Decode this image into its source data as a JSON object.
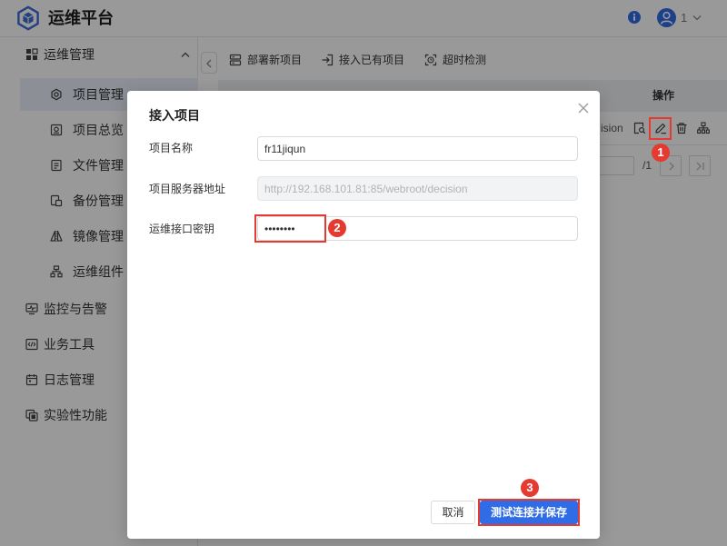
{
  "app": {
    "title": "运维平台",
    "logo_icon": "logo-cube-icon"
  },
  "header": {
    "user_label": "1",
    "icons": {
      "info": "info-icon",
      "avatar": "avatar-icon",
      "dropdown": "chevron-down-icon"
    }
  },
  "sidebar": {
    "section": {
      "label": "运维管理",
      "icon": "grid-icon",
      "expanded": true
    },
    "items": [
      {
        "label": "项目管理",
        "icon": "gear-icon",
        "selected": true
      },
      {
        "label": "项目总览",
        "icon": "overview-icon"
      },
      {
        "label": "文件管理",
        "icon": "file-icon"
      },
      {
        "label": "备份管理",
        "icon": "backup-icon"
      },
      {
        "label": "镜像管理",
        "icon": "mirror-icon"
      },
      {
        "label": "运维组件",
        "icon": "component-icon"
      }
    ],
    "groups": [
      {
        "label": "监控与告警",
        "icon": "monitor-icon"
      },
      {
        "label": "业务工具",
        "icon": "code-icon"
      },
      {
        "label": "日志管理",
        "icon": "calendar-icon"
      },
      {
        "label": "实验性功能",
        "icon": "lab-icon"
      }
    ]
  },
  "toolbar": {
    "deploy_label": "部署新项目",
    "connect_label": "接入已有项目",
    "timeout_label": "超时检测"
  },
  "table": {
    "action_header": "操作",
    "row": {
      "address_visible": "ision",
      "actions": [
        "view-icon",
        "edit-icon",
        "delete-icon",
        "tree-icon"
      ]
    }
  },
  "pagination": {
    "total": "/1"
  },
  "modal": {
    "title": "接入项目",
    "fields": [
      {
        "label": "项目名称",
        "value": "fr11jiqun"
      },
      {
        "label": "项目服务器地址",
        "value": "http://192.168.101.81:85/webroot/decision",
        "disabled": true
      },
      {
        "label": "运维接口密钥",
        "value": "••••••••",
        "type": "password"
      }
    ],
    "cancel_label": "取消",
    "save_label": "测试连接并保存"
  },
  "annotations": {
    "step1": "1",
    "step2": "2",
    "step3": "3"
  },
  "colors": {
    "primary": "#2f6ce5",
    "annotation": "#e53a2f",
    "logo": "#3b6cd4",
    "mask": "rgba(0,0,0,0.4)"
  }
}
